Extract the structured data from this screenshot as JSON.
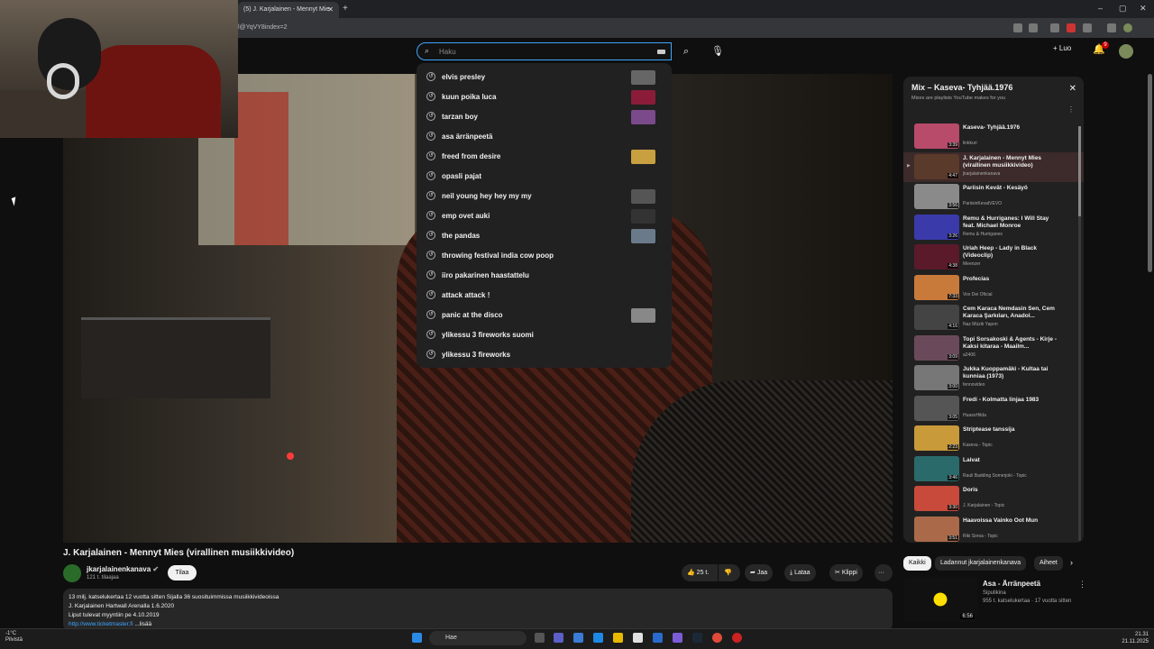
{
  "browser": {
    "tab_title": "(5) J. Karjalainen - Mennyt Mie",
    "tab_close": "✕",
    "new_tab": "+",
    "url": "l@YqVY8index=2",
    "win_min": "–",
    "win_max": "▢",
    "win_close": "✕"
  },
  "header": {
    "search_placeholder": "Haku",
    "create_label": "Luo",
    "notif_count": "9"
  },
  "suggestions": [
    {
      "label": "elvis presley",
      "thumb": true,
      "color": "#666"
    },
    {
      "label": "kuun poika luca",
      "thumb": true,
      "color": "#8a1c3a"
    },
    {
      "label": "tarzan boy",
      "thumb": true,
      "color": "#7a4a8a"
    },
    {
      "label": "asa ärränpeetä",
      "thumb": false,
      "color": ""
    },
    {
      "label": "freed from desire",
      "thumb": true,
      "color": "#c8a040"
    },
    {
      "label": "opasli pajat",
      "thumb": false,
      "color": ""
    },
    {
      "label": "neil young hey hey my my",
      "thumb": true,
      "color": "#555"
    },
    {
      "label": "emp ovet auki",
      "thumb": true,
      "color": "#333"
    },
    {
      "label": "the pandas",
      "thumb": true,
      "color": "#6a7a8a"
    },
    {
      "label": "throwing festival india cow poop",
      "thumb": false,
      "color": ""
    },
    {
      "label": "iiro pakarinen haastattelu",
      "thumb": false,
      "color": ""
    },
    {
      "label": "attack attack !",
      "thumb": false,
      "color": ""
    },
    {
      "label": "panic at the disco",
      "thumb": true,
      "color": "#888"
    },
    {
      "label": "ylikessu 3 fireworks suomi",
      "thumb": false,
      "color": ""
    },
    {
      "label": "ylikessu 3 fireworks",
      "thumb": false,
      "color": ""
    }
  ],
  "video": {
    "title": "J. Karjalainen - Mennyt Mies (virallinen musiikkivideo)",
    "channel": "jkarjalainenkanava",
    "subs": "121 t. tilaajaa",
    "subscribe": "Tilaa",
    "likes": "25 t.",
    "share": "Jaa",
    "download": "Lataa",
    "clip": "Klippi",
    "more": "···",
    "desc_line1": "13 milj. katselukertaa  12 vuotta sitten  Sijalla 36 suosituimmissa musiikkivideoissa",
    "desc_line2": "J. Karjalainen Hartwall Arenalla 1.6.2020",
    "desc_line3": "Liput tulevat myyntiin pe 4.10.2019",
    "desc_link": "http://www.ticketmaster.fi",
    "desc_more": "...lisää"
  },
  "mix": {
    "title": "Mix – Kaseva- Tyhjää.1976",
    "subtitle": "Mixes are playlists YouTube makes for you",
    "items": [
      {
        "title": "Kaseva- Tyhjää.1976",
        "author": "linkkuri",
        "dur": "3:39",
        "color": "#b84a6a",
        "active": false
      },
      {
        "title": "J. Karjalainen - Mennyt Mies (virallinen musiikkivideo)",
        "author": "jkarjalainenkanava",
        "dur": "4:47",
        "color": "#5a3a2a",
        "active": true
      },
      {
        "title": "Pariisin Kevät - Kesäyö",
        "author": "PariisinKevatVEVO",
        "dur": "3:56",
        "color": "#8a8a8a",
        "active": false
      },
      {
        "title": "Remu & Hurriganes: I Will Stay feat. Michael Monroe",
        "author": "Remu & Hurriganes",
        "dur": "3:26",
        "color": "#3a3aaa",
        "active": false
      },
      {
        "title": "Uriah Heep - Lady in Black (Videoclip)",
        "author": "Meenzer",
        "dur": "4:38",
        "color": "#5a1a2a",
        "active": false
      },
      {
        "title": "Profecías",
        "author": "Vox Dei Oficial",
        "dur": "7:33",
        "color": "#c87a3a",
        "active": false
      },
      {
        "title": "Cem Karaca Nemdasin Sen, Cem Karaca Şarkıları, Anadol...",
        "author": "Naz Müzik Yapım",
        "dur": "4:16",
        "color": "#444",
        "active": false
      },
      {
        "title": "Topi Sorsakoski & Agents - Kirje - Kaksi kitaraa - Maailm...",
        "author": "a2406",
        "dur": "3:09",
        "color": "#6a4a5a",
        "active": false
      },
      {
        "title": "Jukka Kuoppamäki - Kultaa tai kunniaa (1973)",
        "author": "fennovideo",
        "dur": "3:00",
        "color": "#777",
        "active": false
      },
      {
        "title": "Fredi - Kolmatta linjaa 1983",
        "author": "HuasoHilda",
        "dur": "3:05",
        "color": "#555",
        "active": false
      },
      {
        "title": "Striptease tanssija",
        "author": "Kaseva - Topic",
        "dur": "2:23",
        "color": "#c89a3a",
        "active": false
      },
      {
        "title": "Laivat",
        "author": "Rauli Badding Somerjoki - Topic",
        "dur": "3:46",
        "color": "#2a6a6a",
        "active": false
      },
      {
        "title": "Doris",
        "author": "J. Karjalainen - Topic",
        "dur": "3:30",
        "color": "#c84a3a",
        "active": false
      },
      {
        "title": "Haavoissa Vainko Oot Mun",
        "author": "Riki Sorsa - Topic",
        "dur": "3:51",
        "color": "#aa6a4a",
        "active": false
      }
    ]
  },
  "chips": [
    "Kaikki",
    "Ladannut jkarjalainenkanava",
    "Aiheet"
  ],
  "rec": {
    "title": "Asa - Ärränpeetä",
    "channel": "Sipulikina",
    "meta": "955 t. katselukertaa · 17 vuotta sitten",
    "dur": "6:56"
  },
  "taskbar": {
    "weather_temp": "-1°C",
    "weather_desc": "Pilvistä",
    "search": "Hae",
    "time": "21.31",
    "date": "21.11.2025"
  }
}
